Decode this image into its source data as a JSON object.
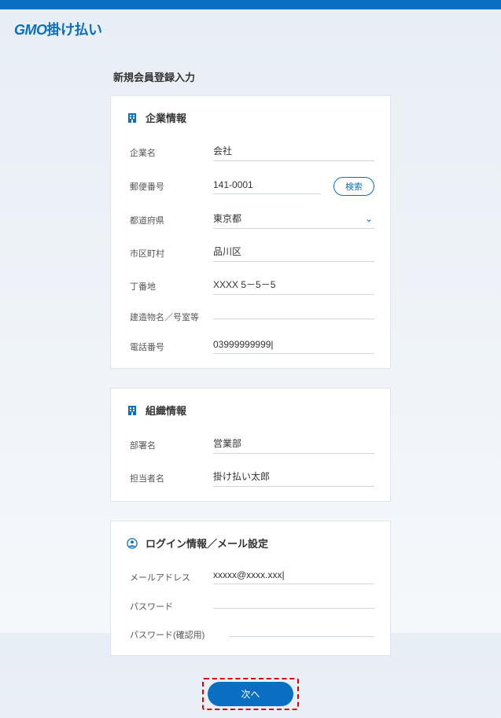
{
  "logo": {
    "prefix": "GMO",
    "suffix": "掛け払い"
  },
  "page_title": "新規会員登録入力",
  "sections": {
    "company": {
      "title": "企業情報",
      "icon": "building-icon",
      "fields": {
        "name_label": "企業名",
        "name_value": "会社",
        "postal_label": "郵便番号",
        "postal_value": "141-0001",
        "search_label": "検索",
        "pref_label": "都道府県",
        "pref_value": "東京都",
        "city_label": "市区町村",
        "city_value": "品川区",
        "block_label": "丁番地",
        "block_value": "XXXX 5－5－5",
        "building_label": "建造物名／号室等",
        "building_value": "",
        "phone_label": "電話番号",
        "phone_value": "03999999999"
      }
    },
    "org": {
      "title": "組織情報",
      "icon": "building-icon",
      "fields": {
        "dept_label": "部署名",
        "dept_value": "営業部",
        "person_label": "担当者名",
        "person_value": "掛け払い太郎"
      }
    },
    "login": {
      "title": "ログイン情報／メール設定",
      "icon": "user-icon",
      "fields": {
        "email_label": "メールアドレス",
        "email_value": "xxxxx@xxxx.xxx",
        "password_label": "パスワード",
        "password_value": "",
        "password_confirm_label": "パスワード(確認用)",
        "password_confirm_value": ""
      }
    }
  },
  "next_button": "次へ"
}
